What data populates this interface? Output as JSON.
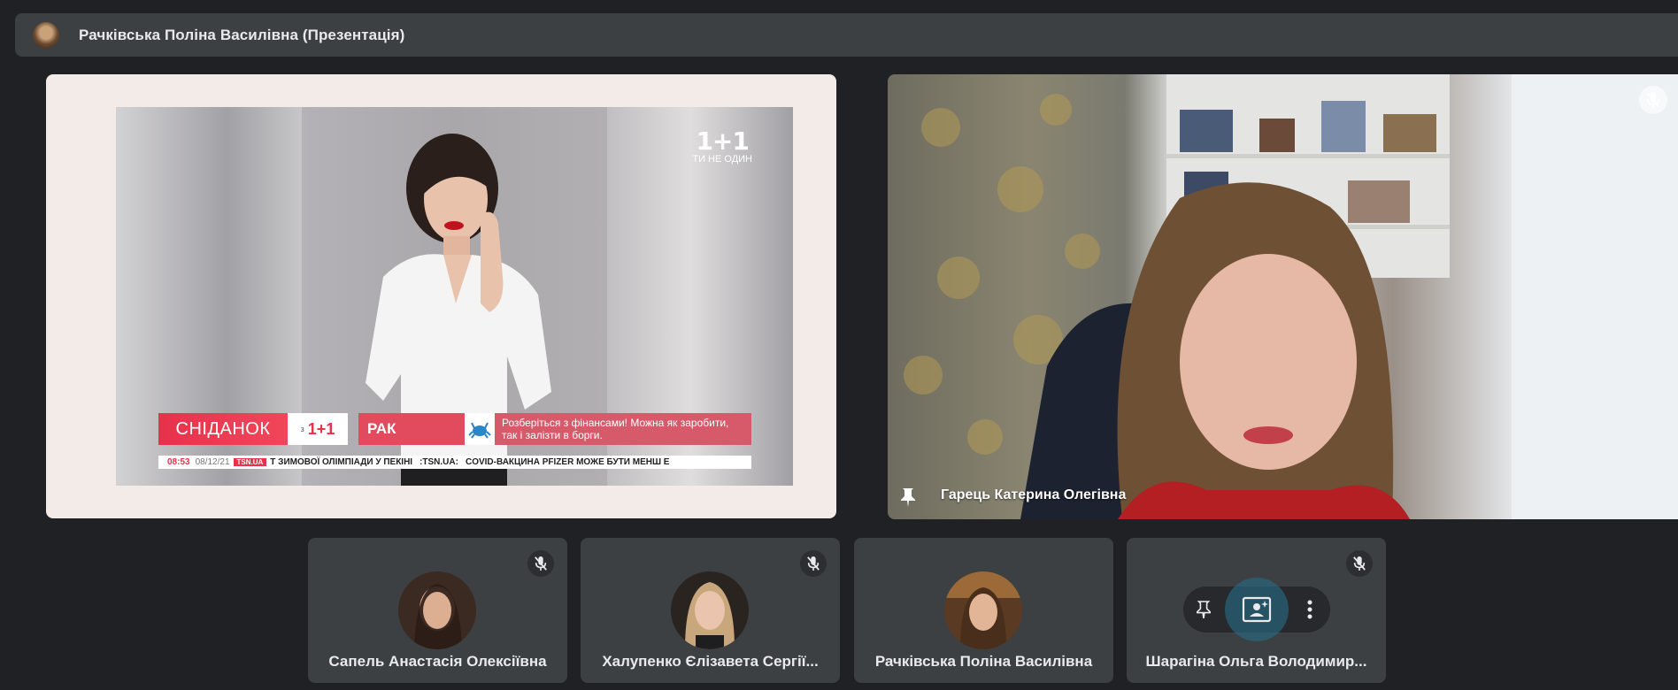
{
  "topbar": {
    "title": "Рачківська Поліна Василівна (Презентація)"
  },
  "presentation": {
    "logo_main": "1+1",
    "logo_tagline": "ТИ НЕ ОДИН",
    "brand": "СНІДАНОК",
    "brand_with": "з",
    "brand_channel": "1+1",
    "zodiac": "РАК",
    "message": "Розберіться з фінансами! Можна як заробити, так і залізти в борги.",
    "ticker_time": "08:53",
    "ticker_date": "08/12/21",
    "ticker_source": "TSN.UA",
    "ticker_text_1": "Т ЗИМОВОЇ ОЛІМПІАДИ У ПЕКІНІ",
    "ticker_text_2": ":TSN.UA:",
    "ticker_text_3": "COVID-ВАКЦИНА PFIZER МОЖЕ БУТИ МЕНШ Е"
  },
  "camera": {
    "name": "Гарець Катерина Олегівна"
  },
  "participants": [
    {
      "name": "Сапель Анастасія Олексіївна"
    },
    {
      "name": "Халупенко Єлізавета Сергії..."
    },
    {
      "name": "Рачківська Поліна Василівна"
    },
    {
      "name": "Шарагіна Ольга Володимир..."
    }
  ],
  "colors": {
    "background": "#202124",
    "tile": "#3c4043",
    "brand_red": "#e6324b"
  }
}
